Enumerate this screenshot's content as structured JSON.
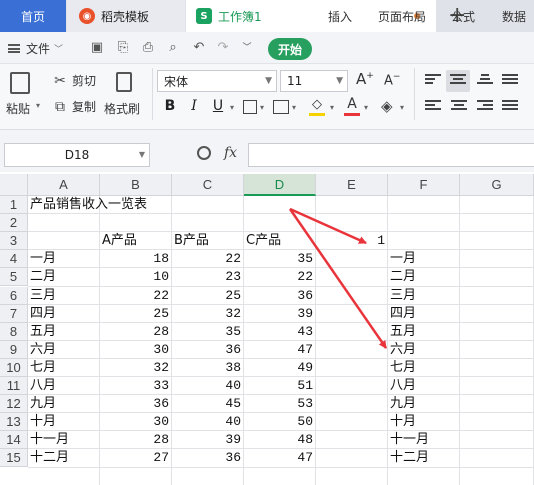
{
  "tabs": {
    "home": "首页",
    "daoke": "稻壳模板",
    "workbook": "工作簿1",
    "new_tab": "+"
  },
  "menu": {
    "file": "文件",
    "start": "开始",
    "insert": "插入",
    "page_layout": "页面布局",
    "formula": "公式",
    "data": "数据"
  },
  "ribbon": {
    "paste": "粘贴",
    "cut": "剪切",
    "copy": "复制",
    "format_painter": "格式刷",
    "font_name": "宋体",
    "font_size": "11",
    "bold": "B",
    "italic": "I",
    "underline": "U",
    "grow_font": "A",
    "shrink_font": "A",
    "font_color_letter": "A"
  },
  "formula_bar": {
    "name_box": "D18",
    "fx": "fx",
    "formula": ""
  },
  "grid": {
    "columns": [
      "A",
      "B",
      "C",
      "D",
      "E",
      "F",
      "G"
    ],
    "selected_column": "D",
    "rows": [
      "1",
      "2",
      "3",
      "4",
      "5",
      "6",
      "7",
      "8",
      "9",
      "10",
      "11",
      "12",
      "13",
      "14",
      "15"
    ],
    "title": "产品销售收入一览表",
    "headers": {
      "B": "A产品",
      "C": "B产品",
      "D": "C产品",
      "E": "1"
    },
    "months": [
      "一月",
      "二月",
      "三月",
      "四月",
      "五月",
      "六月",
      "七月",
      "八月",
      "九月",
      "十月",
      "十一月",
      "十二月"
    ],
    "B": [
      18,
      10,
      22,
      25,
      28,
      30,
      32,
      33,
      36,
      30,
      28,
      27
    ],
    "C": [
      22,
      23,
      25,
      32,
      35,
      36,
      38,
      40,
      45,
      40,
      39,
      36
    ],
    "D": [
      35,
      22,
      36,
      39,
      43,
      47,
      49,
      51,
      53,
      50,
      48,
      47
    ],
    "F": [
      "一月",
      "二月",
      "三月",
      "四月",
      "五月",
      "六月",
      "七月",
      "八月",
      "九月",
      "十月",
      "十一月",
      "十二月"
    ]
  },
  "colors": {
    "accent_green": "#1a9a56",
    "arrow_red": "#e8343a",
    "tab_blue": "#3a6fd6"
  }
}
